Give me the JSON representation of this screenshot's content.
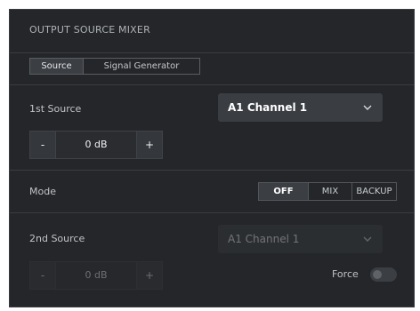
{
  "header": {
    "title": "OUTPUT SOURCE MIXER"
  },
  "tabs": [
    {
      "label": "Source",
      "active": true
    },
    {
      "label": "Signal Generator",
      "active": false
    }
  ],
  "first_source": {
    "label": "1st Source",
    "select_value": "A1 Channel 1",
    "stepper": {
      "minus": "-",
      "value": "0 dB",
      "plus": "+"
    }
  },
  "mode": {
    "label": "Mode",
    "options": [
      "OFF",
      "MIX",
      "BACKUP"
    ],
    "selected": "OFF"
  },
  "second_source": {
    "label": "2nd Source",
    "select_value": "A1 Channel 1",
    "stepper": {
      "minus": "-",
      "value": "0 dB",
      "plus": "+"
    },
    "force_label": "Force",
    "force_on": false,
    "disabled": true
  },
  "icons": {
    "select_chevron": "chevron-down-icon"
  },
  "colors": {
    "panel_bg": "#242629",
    "control_bg": "#3a3d42",
    "text": "#c0c3c7"
  }
}
